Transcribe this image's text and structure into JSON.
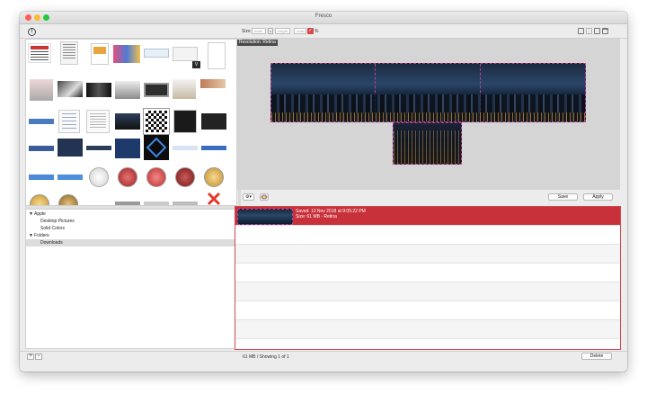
{
  "window": {
    "title": "Fresco"
  },
  "toolbar": {
    "size_label": "Size",
    "width_placeholder": "width",
    "lock_glyph": "x",
    "height_placeholder": "height",
    "scale_placeholder": "scale",
    "percent_label": "%",
    "checkbox_glyph": "✓"
  },
  "info_glyph": "!",
  "preview": {
    "resolution_label": "Resolution: Retina"
  },
  "preview_bar": {
    "gear_glyph": "⚙▾",
    "save_label": "Save",
    "apply_label": "Apply"
  },
  "sidebar": {
    "items": [
      {
        "label": "Apple",
        "disclosure": "▼"
      },
      {
        "label": "Desktop Pictures"
      },
      {
        "label": "Solid Colors"
      },
      {
        "label": "Folders",
        "disclosure": "▼"
      },
      {
        "label": "Downloads"
      }
    ]
  },
  "saved_item": {
    "line1": "Saved: 13 Nov 2018 at 9:05:22 PM",
    "line2": "Size: 61 MB - Retina"
  },
  "bottombar": {
    "add_glyph": "+",
    "remove_glyph": "−",
    "status": "61 MB / Showing 1 of 1",
    "delete_label": "Delete"
  },
  "thumb_badge": "V",
  "colors": {
    "accent": "#c9313a",
    "selection": "#dcdcdc"
  }
}
